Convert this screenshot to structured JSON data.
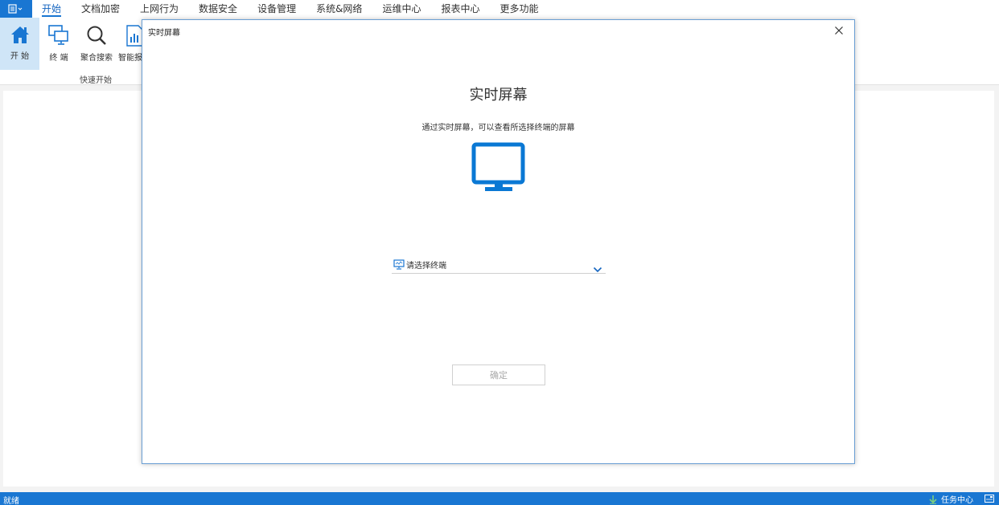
{
  "menu": {
    "tabs": [
      "开始",
      "文档加密",
      "上网行为",
      "数据安全",
      "设备管理",
      "系统&网络",
      "运维中心",
      "报表中心",
      "更多功能"
    ],
    "active_index": 0
  },
  "ribbon": {
    "buttons": [
      {
        "label": "开  始",
        "icon": "home-icon"
      },
      {
        "label": "终  端",
        "icon": "terminal-icon"
      },
      {
        "label": "聚合搜索",
        "icon": "search-icon"
      },
      {
        "label": "智能报",
        "icon": "report-icon"
      }
    ],
    "group_label": "快速开始"
  },
  "dialog": {
    "title": "实时屏幕",
    "heading": "实时屏幕",
    "description": "通过实时屏幕，可以查看所选择终端的屏幕",
    "select_placeholder": "请选择终端",
    "confirm_label": "确定"
  },
  "status": {
    "text": "就绪",
    "task_center": "任务中心"
  },
  "colors": {
    "accent": "#1976d2",
    "monitor": "#0a78d4",
    "selected_bg": "#cfe5f7"
  }
}
